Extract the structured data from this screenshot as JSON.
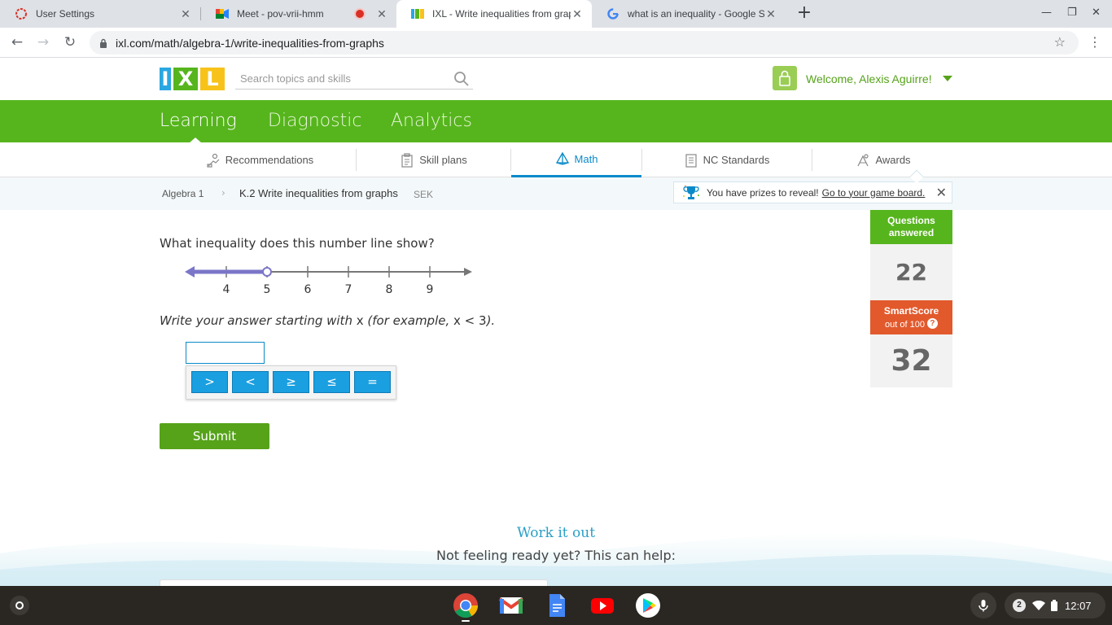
{
  "browser": {
    "tabs": [
      {
        "title": "User Settings",
        "close": "✕"
      },
      {
        "title": "Meet - pov-vrii-hmm",
        "close": "✕"
      },
      {
        "title": "IXL - Write inequalities from grap",
        "close": "✕"
      },
      {
        "title": "what is an inequality - Google Se",
        "close": "✕"
      }
    ],
    "new_tab": "+",
    "url": "ixl.com/math/algebra-1/write-inequalities-from-graphs"
  },
  "header": {
    "logo": [
      "I",
      "X",
      "L"
    ],
    "search_placeholder": "Search topics and skills",
    "welcome": "Welcome, Alexis Aguirre!"
  },
  "nav": {
    "items": [
      "Learning",
      "Diagnostic",
      "Analytics"
    ],
    "active": "Learning"
  },
  "subnav": {
    "items": [
      "Recommendations",
      "Skill plans",
      "Math",
      "NC Standards",
      "Awards"
    ],
    "active": "Math"
  },
  "breadcrumb": {
    "parent": "Algebra 1",
    "current": "K.2 Write inequalities from graphs",
    "code": "SEK"
  },
  "prize_banner": {
    "text": "You have prizes to reveal!",
    "link": "Go to your game board."
  },
  "question": {
    "prompt": "What inequality does this number line show?",
    "instruction_pre": "Write your answer starting with",
    "instruction_var": "x",
    "instruction_mid": "(for example,",
    "instruction_example": "x < 3",
    "instruction_post": ").",
    "answer_value": "",
    "ticks": [
      "4",
      "5",
      "6",
      "7",
      "8",
      "9"
    ],
    "open_circle_at": "5",
    "ray_direction": "left"
  },
  "keypad": {
    "keys": [
      ">",
      "<",
      "≥",
      "≤",
      "="
    ]
  },
  "submit_label": "Submit",
  "stats": {
    "questions_label": "Questions answered",
    "questions_value": "22",
    "smartscore_label": "SmartScore",
    "smartscore_sub": "out of 100",
    "smartscore_help": "?",
    "smartscore_value": "32"
  },
  "work_it_out": {
    "title": "Work it out",
    "subtitle": "Not feeling ready yet? This can help:"
  },
  "shelf": {
    "notifications": "2",
    "clock": "12:07"
  },
  "colors": {
    "ixl_green": "#56b51d",
    "ixl_blue": "#0a8ac9",
    "smartscore_orange": "#e2592c",
    "numberline_purple": "#7b76c8"
  }
}
